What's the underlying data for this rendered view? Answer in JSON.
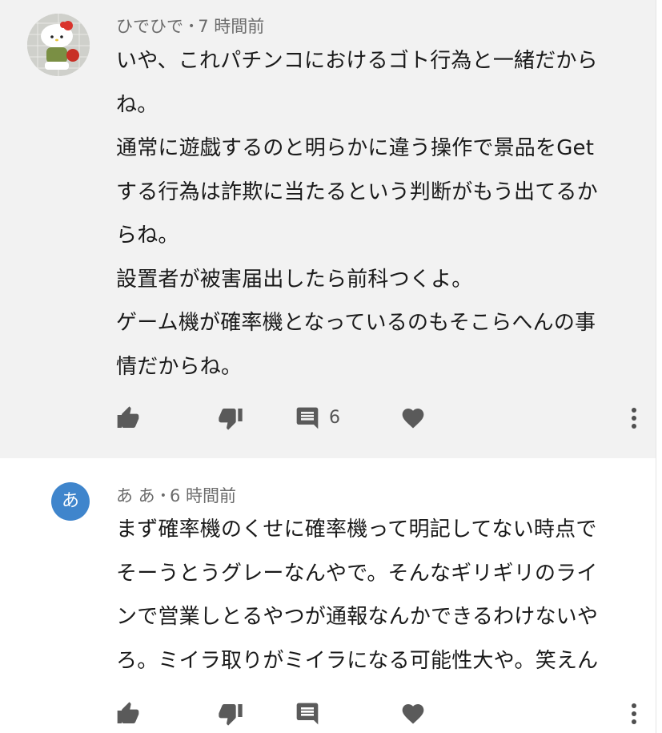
{
  "comments": [
    {
      "author": "ひでひで",
      "dot": "•",
      "time": "7 時間前",
      "lines": [
        "いや、これパチンコにおけるゴト行為と一緒だから",
        "ね。",
        "通常に遊戯するのと明らかに違う操作で景品をGet",
        "する行為は詐欺に当たるという判断がもう出てるか",
        "らね。",
        "設置者が被害届出したら前科つくよ。",
        "ゲーム機が確率機となっているのもそこらへんの事",
        "情だからね。"
      ],
      "reply_count": "6",
      "avatar": "hello-kitty-figure-photo"
    },
    {
      "author": "あ あ",
      "dot": "•",
      "time": "6 時間前",
      "avatar_letter": "あ",
      "avatar_color": "#3f85cc",
      "lines": [
        "まず確率機のくせに確率機って明記してない時点で",
        "そーうとうグレーなんやで。そんなギリギリのライ",
        "ンで営業しとるやつが通報なんかできるわけないや",
        "ろ。ミイラ取りがミイラになる可能性大や。笑えん"
      ]
    }
  ],
  "icons": {
    "like": "thumbs-up-icon",
    "dislike": "thumbs-down-icon",
    "reply": "comment-icon",
    "heart": "heart-icon",
    "more": "more-vertical-icon"
  },
  "colors": {
    "highlight_bg": "#f2f2f2",
    "icon": "#5a5a5a",
    "meta_text": "#6b6b6b",
    "body_text": "#1a1a1a"
  }
}
